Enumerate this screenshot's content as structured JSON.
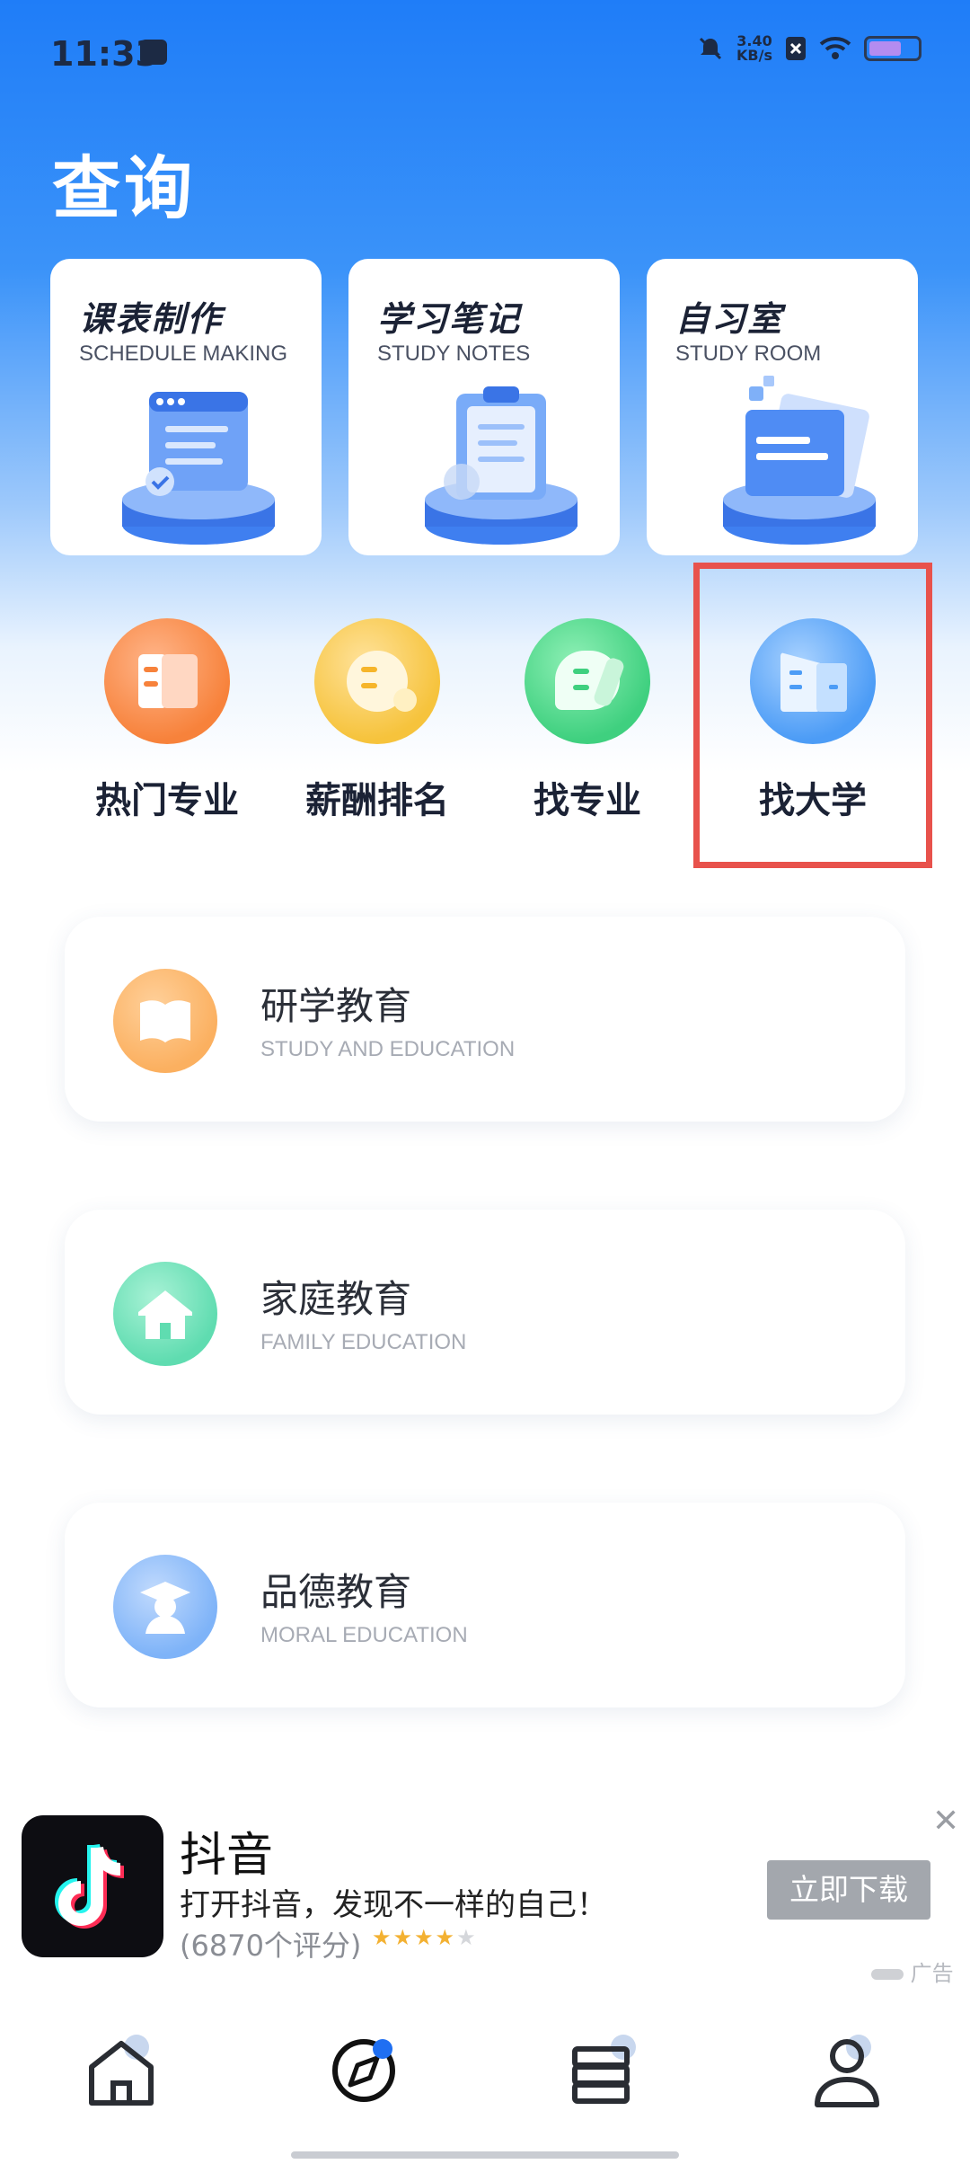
{
  "status_bar": {
    "time": "11:33",
    "net_speed_value": "3.40",
    "net_speed_unit": "KB/s"
  },
  "page_title": "查询",
  "feature_cards": [
    {
      "title": "课表制作",
      "subtitle": "SCHEDULE MAKING",
      "icon": "schedule-icon"
    },
    {
      "title": "学习笔记",
      "subtitle": "STUDY NOTES",
      "icon": "clipboard-icon"
    },
    {
      "title": "自习室",
      "subtitle": "STUDY ROOM",
      "icon": "folder-icon"
    }
  ],
  "quick_entries": [
    {
      "label": "热门专业",
      "icon": "hot-major-icon",
      "color": "#f7823b"
    },
    {
      "label": "薪酬排名",
      "icon": "salary-ranking-icon",
      "color": "#f6c33c"
    },
    {
      "label": "找专业",
      "icon": "find-major-icon",
      "color": "#3fd07f"
    },
    {
      "label": "找大学",
      "icon": "find-university-icon",
      "color": "#4c9cf6"
    }
  ],
  "education_list": [
    {
      "title": "研学教育",
      "subtitle": "STUDY AND EDUCATION",
      "icon": "book-icon",
      "color": "#fbb060"
    },
    {
      "title": "家庭教育",
      "subtitle": "FAMILY EDUCATION",
      "icon": "house-icon",
      "color": "#5fdcb0"
    },
    {
      "title": "品德教育",
      "subtitle": "MORAL EDUCATION",
      "icon": "graduate-icon",
      "color": "#7eb3f8"
    }
  ],
  "ad": {
    "app_name": "抖音",
    "description": "打开抖音，发现不一样的自己！",
    "rating_text": "(6870个评分)",
    "rating": 4,
    "cta": "立即下载",
    "tag": "广告"
  },
  "bottom_nav": [
    {
      "name": "home",
      "icon": "home-icon"
    },
    {
      "name": "discover",
      "icon": "compass-icon",
      "active": true
    },
    {
      "name": "library",
      "icon": "books-icon"
    },
    {
      "name": "profile",
      "icon": "user-icon"
    }
  ],
  "colors": {
    "accent": "#1f7df8",
    "highlight": "#e8524c"
  }
}
